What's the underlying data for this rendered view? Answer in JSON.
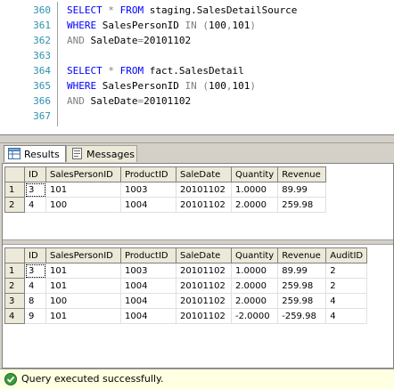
{
  "editor": {
    "lines": [
      {
        "num": "360",
        "parts": [
          {
            "t": "SELECT",
            "c": "kw"
          },
          {
            "t": " ",
            "c": ""
          },
          {
            "t": "*",
            "c": "op"
          },
          {
            "t": " ",
            "c": ""
          },
          {
            "t": "FROM",
            "c": "kw"
          },
          {
            "t": " staging.SalesDetailSource",
            "c": ""
          }
        ]
      },
      {
        "num": "361",
        "parts": [
          {
            "t": "WHERE",
            "c": "kw"
          },
          {
            "t": " SalesPersonID ",
            "c": ""
          },
          {
            "t": "IN",
            "c": "op"
          },
          {
            "t": " ",
            "c": ""
          },
          {
            "t": "(",
            "c": "op"
          },
          {
            "t": "100",
            "c": ""
          },
          {
            "t": ",",
            "c": "op"
          },
          {
            "t": "101",
            "c": ""
          },
          {
            "t": ")",
            "c": "op"
          }
        ]
      },
      {
        "num": "362",
        "parts": [
          {
            "t": "AND",
            "c": "op"
          },
          {
            "t": " SaleDate",
            "c": ""
          },
          {
            "t": "=",
            "c": "op"
          },
          {
            "t": "20101102",
            "c": ""
          }
        ]
      },
      {
        "num": "363",
        "parts": []
      },
      {
        "num": "364",
        "parts": [
          {
            "t": "SELECT",
            "c": "kw"
          },
          {
            "t": " ",
            "c": ""
          },
          {
            "t": "*",
            "c": "op"
          },
          {
            "t": " ",
            "c": ""
          },
          {
            "t": "FROM",
            "c": "kw"
          },
          {
            "t": " fact.SalesDetail",
            "c": ""
          }
        ]
      },
      {
        "num": "365",
        "parts": [
          {
            "t": "WHERE",
            "c": "kw"
          },
          {
            "t": " SalesPersonID ",
            "c": ""
          },
          {
            "t": "IN",
            "c": "op"
          },
          {
            "t": " ",
            "c": ""
          },
          {
            "t": "(",
            "c": "op"
          },
          {
            "t": "100",
            "c": ""
          },
          {
            "t": ",",
            "c": "op"
          },
          {
            "t": "101",
            "c": ""
          },
          {
            "t": ")",
            "c": "op"
          }
        ]
      },
      {
        "num": "366",
        "parts": [
          {
            "t": "AND",
            "c": "op"
          },
          {
            "t": " SaleDate",
            "c": ""
          },
          {
            "t": "=",
            "c": "op"
          },
          {
            "t": "20101102",
            "c": ""
          }
        ]
      },
      {
        "num": "367",
        "parts": []
      }
    ]
  },
  "tabs": {
    "results": "Results",
    "messages": "Messages"
  },
  "grid1": {
    "columns": [
      "ID",
      "SalesPersonID",
      "ProductID",
      "SaleDate",
      "Quantity",
      "Revenue"
    ],
    "rows": [
      {
        "num": "1",
        "cells": [
          "3",
          "101",
          "1003",
          "20101102",
          "1.0000",
          "89.99"
        ]
      },
      {
        "num": "2",
        "cells": [
          "4",
          "100",
          "1004",
          "20101102",
          "2.0000",
          "259.98"
        ]
      }
    ]
  },
  "grid2": {
    "columns": [
      "ID",
      "SalesPersonID",
      "ProductID",
      "SaleDate",
      "Quantity",
      "Revenue",
      "AuditID"
    ],
    "rows": [
      {
        "num": "1",
        "cells": [
          "3",
          "101",
          "1003",
          "20101102",
          "1.0000",
          "89.99",
          "2"
        ]
      },
      {
        "num": "2",
        "cells": [
          "4",
          "101",
          "1004",
          "20101102",
          "2.0000",
          "259.98",
          "2"
        ]
      },
      {
        "num": "3",
        "cells": [
          "8",
          "100",
          "1004",
          "20101102",
          "2.0000",
          "259.98",
          "4"
        ]
      },
      {
        "num": "4",
        "cells": [
          "9",
          "101",
          "1004",
          "20101102",
          "-2.0000",
          "-259.98",
          "4"
        ]
      }
    ]
  },
  "status": {
    "message": "Query executed successfully.",
    "icon": "check-circle-icon",
    "icon_color": "#2e8b2e"
  }
}
